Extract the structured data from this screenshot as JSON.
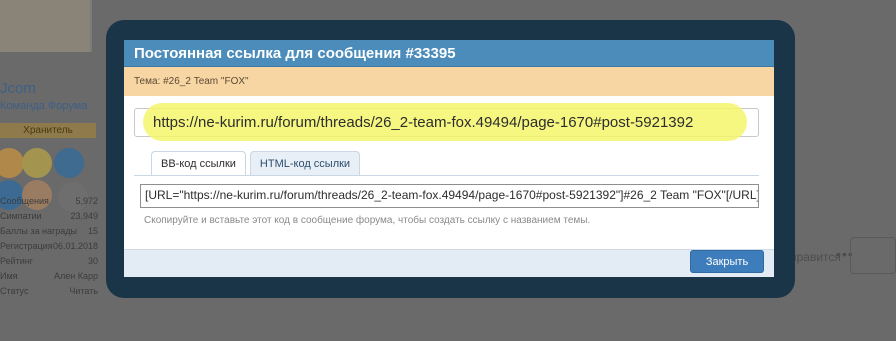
{
  "background": {
    "username": "Jcom",
    "user_title": "Команда Форума",
    "rank": "Хранитель",
    "stats": [
      {
        "label": "Сообщения",
        "value": "5,972"
      },
      {
        "label": "Симпатии",
        "value": "23,949"
      },
      {
        "label": "Баллы за награды",
        "value": "15"
      },
      {
        "label": "Регистрация",
        "value": "06.01.2018"
      },
      {
        "label": "Рейтинг",
        "value": "30"
      },
      {
        "label": "Имя",
        "value": "Ален Карр"
      },
      {
        "label": "Статус",
        "value": "Читать"
      }
    ],
    "side_text": "нравится",
    "dots": "•••"
  },
  "dialog": {
    "title": "Постоянная ссылка для сообщения #33395",
    "subheader": "Тема: #26_2 Team \"FOX\"",
    "link": "https://ne-kurim.ru/forum/threads/26_2-team-fox.49494/page-1670#post-5921392",
    "tabs": [
      {
        "label": "BB-код ссылки",
        "active": true
      },
      {
        "label": "HTML-код ссылки",
        "active": false
      }
    ],
    "bbcode_value": "[URL=\"https://ne-kurim.ru/forum/threads/26_2-team-fox.49494/page-1670#post-5921392\"]#26_2 Team \"FOX\"[/URL]",
    "hint": "Скопируйте и вставьте этот код в сообщение форума, чтобы создать ссылку с названием темы.",
    "close_label": "Закрыть"
  },
  "colors": {
    "title_bar": "#4c8cbb",
    "subheader": "#f8d6a4",
    "highlight": "#f4f66a",
    "button": "#3e7dbb",
    "overlay_frame": "#1a3548"
  }
}
